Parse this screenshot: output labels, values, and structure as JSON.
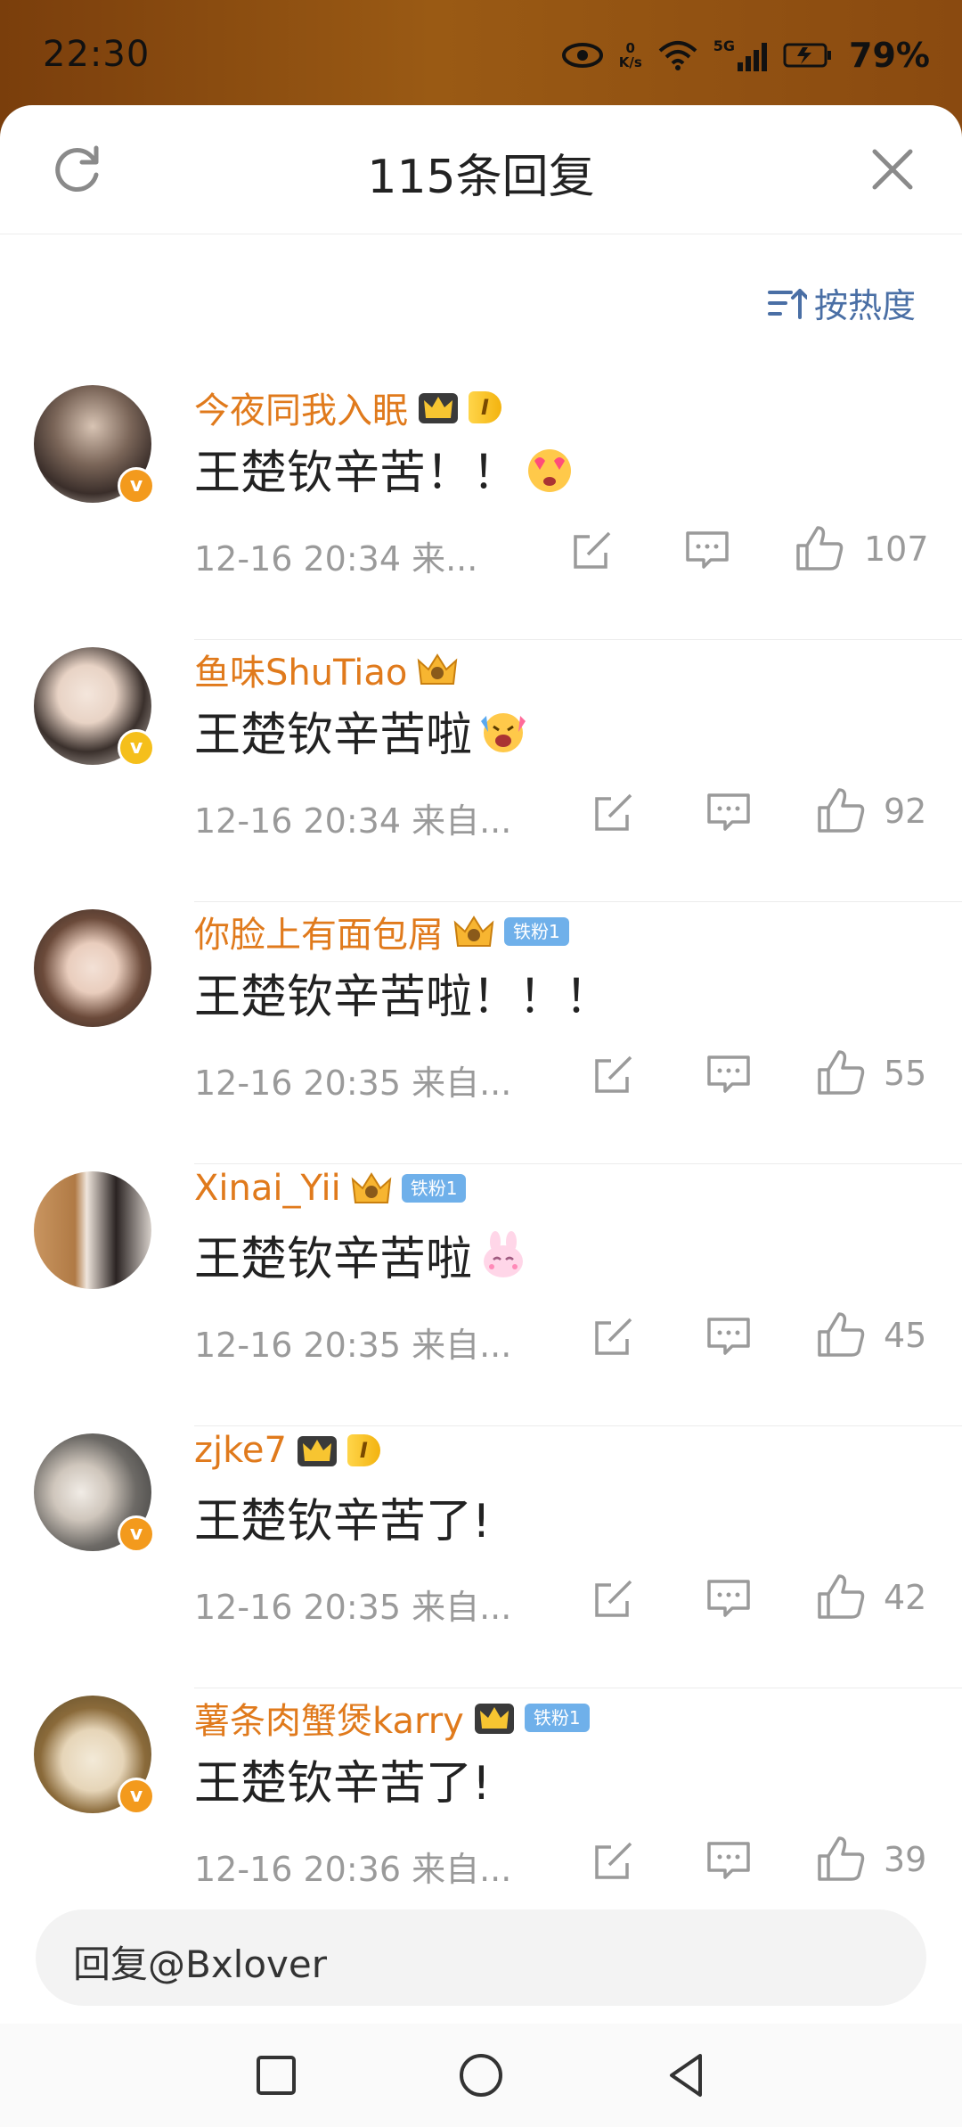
{
  "status": {
    "time": "22:30",
    "net_speed_top": "0",
    "net_speed_bottom": "K/s",
    "network": "5G",
    "battery": "79%",
    "icons": [
      "eye-icon",
      "wifi-icon",
      "signal-icon",
      "battery-icon"
    ]
  },
  "header": {
    "title": "115条回复",
    "refresh_icon": "refresh-icon",
    "close_icon": "close-icon"
  },
  "sort": {
    "label": "按热度",
    "icon": "sort-icon"
  },
  "comments": [
    {
      "name": "今夜同我入眠",
      "badge": "I",
      "fan": "",
      "text": "王楚钦辛苦！！",
      "emoji": "heart-eyes-emoji",
      "meta": "12-16 20:34 来...",
      "likes": "107",
      "verified": "orange"
    },
    {
      "name": "鱼味ShuTiao",
      "badge": "",
      "fan": "",
      "text": "王楚钦辛苦啦",
      "emoji": "cheering-emoji",
      "meta": "12-16 20:34 来自...",
      "likes": "92",
      "verified": "gold"
    },
    {
      "name": "你脸上有面包屑",
      "badge": "",
      "fan": "铁粉1",
      "text": "王楚钦辛苦啦！！！",
      "emoji": "",
      "meta": "12-16 20:35 来自...",
      "likes": "55",
      "verified": ""
    },
    {
      "name": "Xinai_Yii",
      "badge": "",
      "fan": "铁粉1",
      "text": "王楚钦辛苦啦",
      "emoji": "bunny-emoji",
      "meta": "12-16 20:35 来自...",
      "likes": "45",
      "verified": ""
    },
    {
      "name": "zjke7",
      "badge": "I",
      "fan": "",
      "text": "王楚钦辛苦了!",
      "emoji": "",
      "meta": "12-16 20:35 来自...",
      "likes": "42",
      "verified": "orange"
    },
    {
      "name": "薯条肉蟹煲karry",
      "badge": "",
      "fan": "铁粉1",
      "text": "王楚钦辛苦了!",
      "emoji": "",
      "meta": "12-16 20:36 来自...",
      "likes": "39",
      "verified": "orange"
    }
  ],
  "reply": {
    "placeholder": "回复@Bxlover"
  },
  "nav": {
    "recent": "square-icon",
    "home": "circle-icon",
    "back": "triangle-back-icon"
  },
  "colors": {
    "username": "#e07a1c",
    "sort": "#4a6fa5",
    "meta": "#9a9a9a",
    "verified": "#f39a1d"
  }
}
